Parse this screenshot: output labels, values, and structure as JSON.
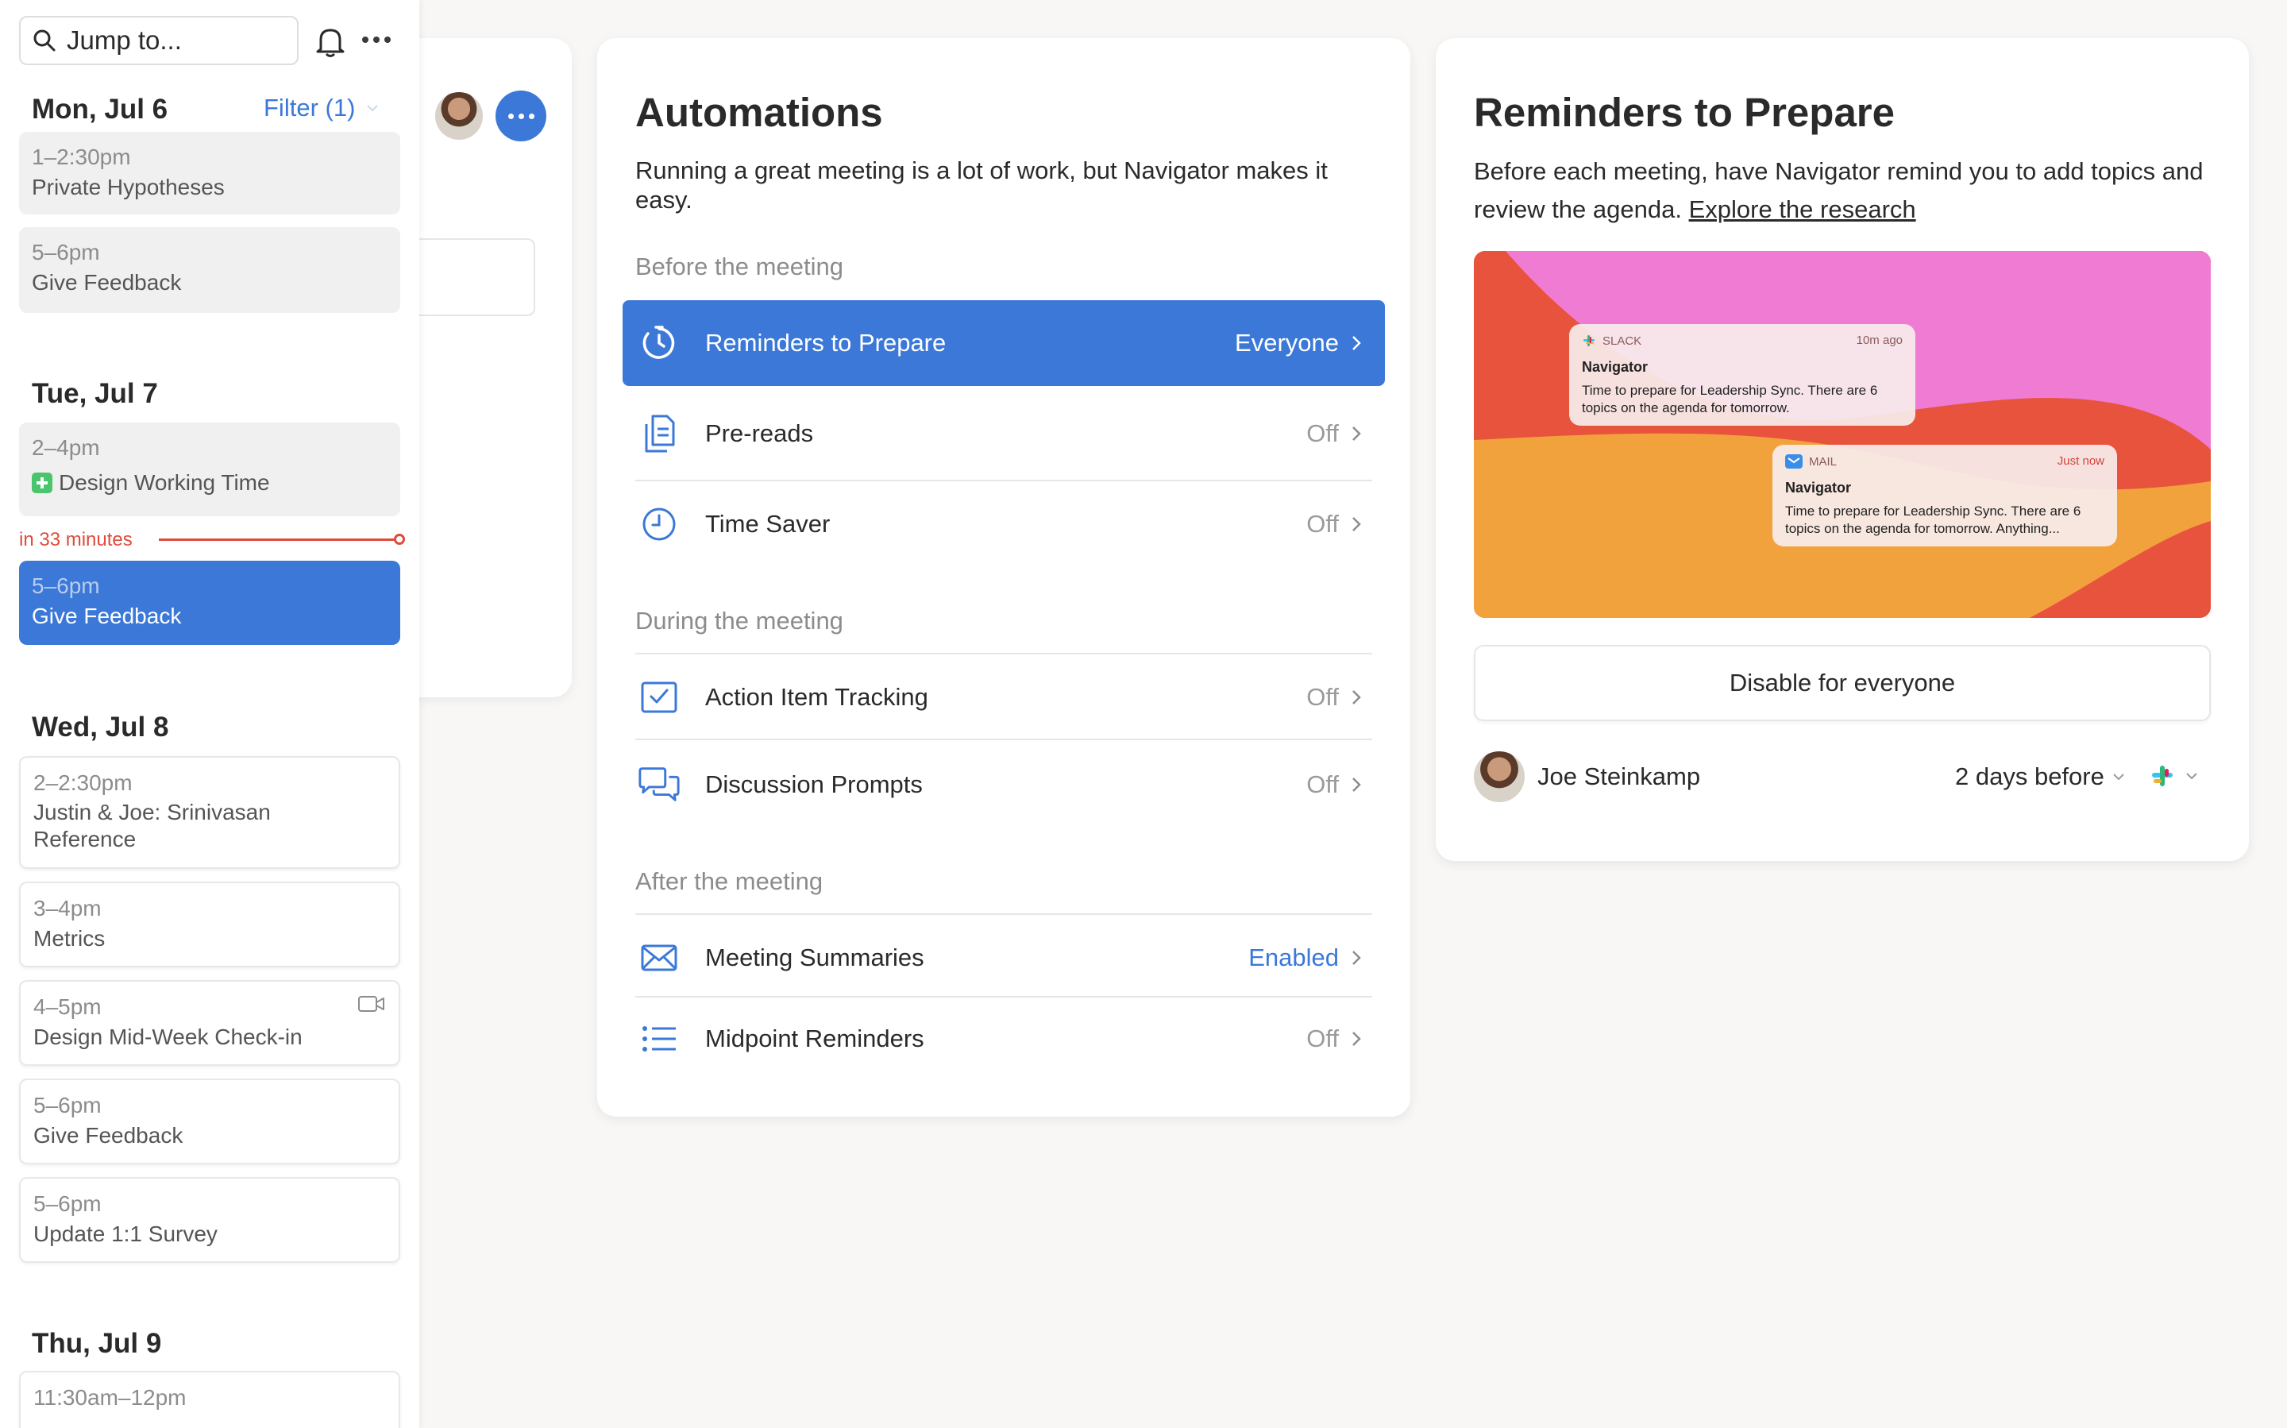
{
  "sidebar": {
    "search_placeholder": "Jump to...",
    "filter_label": "Filter (1)",
    "now_indicator": "in 33 minutes",
    "days": [
      {
        "label": "Mon, Jul 6",
        "events": [
          {
            "time": "1–2:30pm",
            "name": "Private Hypotheses"
          },
          {
            "time": "5–6pm",
            "name": "Give Feedback"
          }
        ]
      },
      {
        "label": "Tue, Jul 7",
        "events": [
          {
            "time": "2–4pm",
            "name": "Design Working Time"
          },
          {
            "time": "5–6pm",
            "name": "Give Feedback"
          }
        ]
      },
      {
        "label": "Wed, Jul 8",
        "events": [
          {
            "time": "2–2:30pm",
            "name": "Justin & Joe: Srinivasan Reference"
          },
          {
            "time": "3–4pm",
            "name": "Metrics"
          },
          {
            "time": "4–5pm",
            "name": "Design Mid-Week Check-in"
          },
          {
            "time": "5–6pm",
            "name": "Give Feedback"
          },
          {
            "time": "5–6pm",
            "name": "Update 1:1 Survey"
          }
        ]
      },
      {
        "label": "Thu, Jul 9",
        "events": [
          {
            "time": "11:30am–12pm",
            "name": ""
          }
        ]
      }
    ]
  },
  "automations": {
    "title": "Automations",
    "description": "Running a great meeting is a lot of work, but Navigator makes it easy.",
    "sections": [
      {
        "label": "Before the meeting",
        "items": [
          {
            "label": "Reminders to Prepare",
            "value": "Everyone",
            "icon": "timer-icon",
            "selected": true
          },
          {
            "label": "Pre-reads",
            "value": "Off",
            "icon": "documents-icon"
          },
          {
            "label": "Time Saver",
            "value": "Off",
            "icon": "clock-icon"
          }
        ]
      },
      {
        "label": "During the meeting",
        "items": [
          {
            "label": "Action Item Tracking",
            "value": "Off",
            "icon": "checkbox-icon"
          },
          {
            "label": "Discussion Prompts",
            "value": "Off",
            "icon": "chat-bubbles-icon"
          }
        ]
      },
      {
        "label": "After the meeting",
        "items": [
          {
            "label": "Meeting Summaries",
            "value": "Enabled",
            "icon": "mail-icon"
          },
          {
            "label": "Midpoint Reminders",
            "value": "Off",
            "icon": "list-icon"
          }
        ]
      }
    ]
  },
  "reminders": {
    "title": "Reminders to Prepare",
    "description": "Before each meeting, have Navigator remind you to add topics and review the agenda.",
    "link": "Explore the research",
    "notifications": [
      {
        "app": "SLACK",
        "time": "10m ago",
        "title": "Navigator",
        "body": "Time to prepare for Leadership Sync. There are 6 topics on the agenda for tomorrow."
      },
      {
        "app": "MAIL",
        "time": "Just now",
        "title": "Navigator",
        "body": "Time to prepare for Leadership Sync. There are 6 topics on the agenda for tomorrow. Anything..."
      }
    ],
    "disable_button": "Disable for everyone",
    "person": {
      "name": "Joe Steinkamp",
      "timing": "2 days before",
      "channel_icon": "slack-icon"
    }
  },
  "colors": {
    "accent": "#3b78d8",
    "alert": "#e04a3a",
    "hero_pink": "#ef7bd3",
    "hero_red": "#e8533d",
    "hero_orange": "#f2a23c"
  }
}
